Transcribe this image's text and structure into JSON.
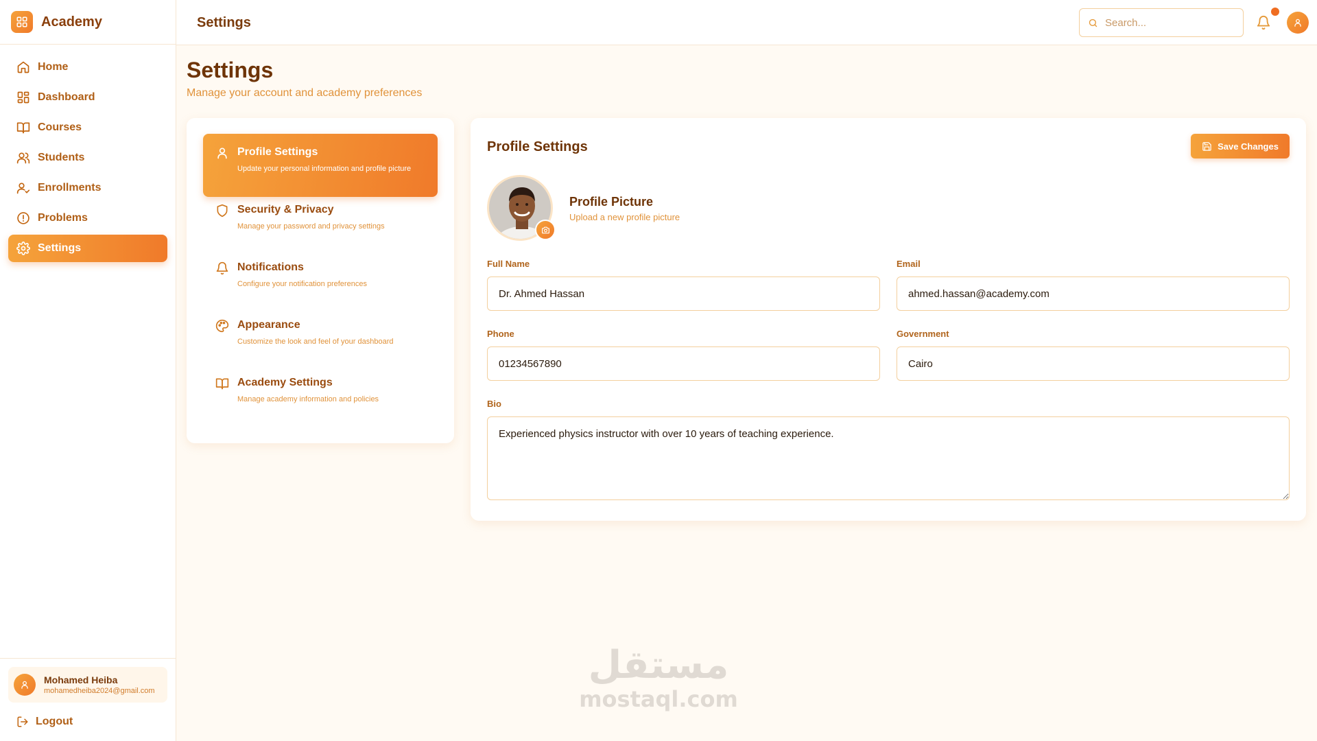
{
  "colors": {
    "accent": "#f07a2a",
    "accent_light": "#f5a33b",
    "text_dark": "#6e3407",
    "text_muted": "#e0923a"
  },
  "app": {
    "name": "Academy",
    "logo_icon": "grid-icon"
  },
  "sidebar": {
    "items": [
      {
        "label": "Home",
        "icon": "home-icon",
        "active": false
      },
      {
        "label": "Dashboard",
        "icon": "grid-icon",
        "active": false
      },
      {
        "label": "Courses",
        "icon": "book-open-icon",
        "active": false
      },
      {
        "label": "Students",
        "icon": "users-icon",
        "active": false
      },
      {
        "label": "Enrollments",
        "icon": "user-check-icon",
        "active": false
      },
      {
        "label": "Problems",
        "icon": "alert-circle-icon",
        "active": false
      },
      {
        "label": "Settings",
        "icon": "gear-icon",
        "active": true
      }
    ],
    "user": {
      "name": "Mohamed Heiba",
      "email": "mohamedheiba2024@gmail.com"
    },
    "logout_label": "Logout"
  },
  "topbar": {
    "title": "Settings",
    "search_placeholder": "Search..."
  },
  "page": {
    "title": "Settings",
    "subtitle": "Manage your account and academy preferences"
  },
  "settings_menu": [
    {
      "label": "Profile Settings",
      "desc": "Update your personal information and profile picture",
      "icon": "user-icon",
      "active": true
    },
    {
      "label": "Security & Privacy",
      "desc": "Manage your password and privacy settings",
      "icon": "shield-icon",
      "active": false
    },
    {
      "label": "Notifications",
      "desc": "Configure your notification preferences",
      "icon": "bell-icon",
      "active": false
    },
    {
      "label": "Appearance",
      "desc": "Customize the look and feel of your dashboard",
      "icon": "palette-icon",
      "active": false
    },
    {
      "label": "Academy Settings",
      "desc": "Manage academy information and policies",
      "icon": "book-open-icon",
      "active": false
    }
  ],
  "profile": {
    "title": "Profile Settings",
    "save_label": "Save Changes",
    "picture_title": "Profile Picture",
    "picture_sub": "Upload a new profile picture",
    "fields": {
      "full_name": {
        "label": "Full Name",
        "value": "Dr. Ahmed Hassan"
      },
      "email": {
        "label": "Email",
        "value": "ahmed.hassan@academy.com"
      },
      "phone": {
        "label": "Phone",
        "value": "01234567890"
      },
      "government": {
        "label": "Government",
        "value": "Cairo"
      },
      "bio": {
        "label": "Bio",
        "value": "Experienced physics instructor with over 10 years of teaching experience."
      }
    }
  },
  "watermark": {
    "arabic": "مستقل",
    "latin": "mostaql.com"
  }
}
